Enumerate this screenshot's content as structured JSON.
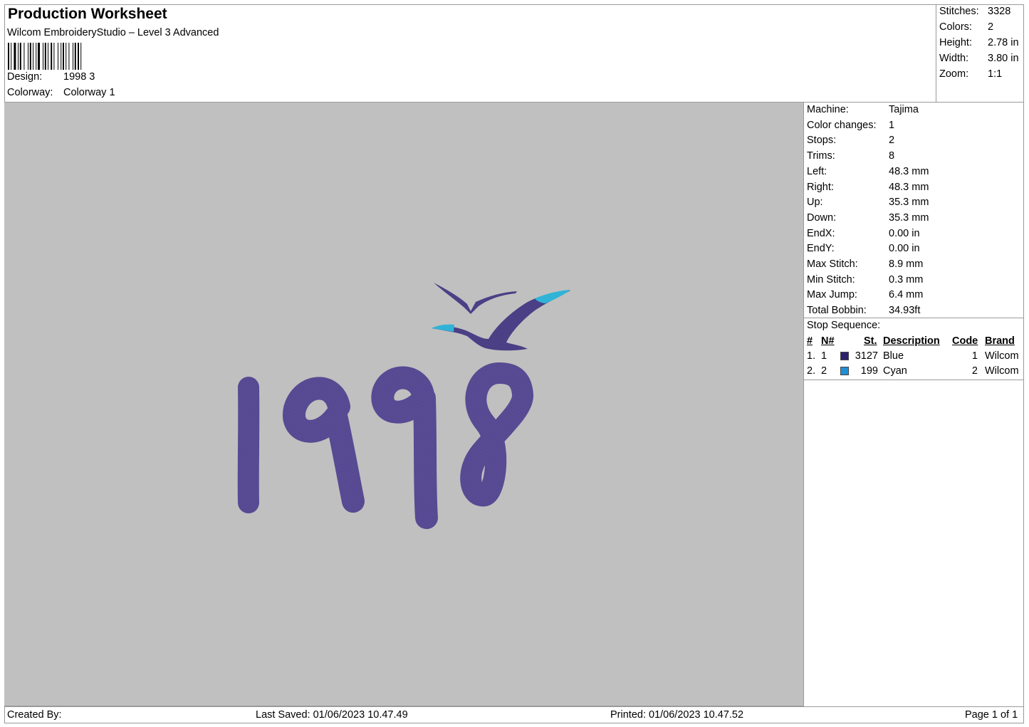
{
  "header": {
    "title": "Production Worksheet",
    "subtitle": "Wilcom EmbroideryStudio – Level 3 Advanced",
    "design_label": "Design:",
    "design_value": "1998 3",
    "colorway_label": "Colorway:",
    "colorway_value": "Colorway 1"
  },
  "stats": {
    "stitches_label": "Stitches:",
    "stitches_value": "3328",
    "colors_label": "Colors:",
    "colors_value": "2",
    "height_label": "Height:",
    "height_value": "2.78 in",
    "width_label": "Width:",
    "width_value": "3.80 in",
    "zoom_label": "Zoom:",
    "zoom_value": "1:1"
  },
  "machine_info": [
    {
      "label": "Machine:",
      "value": "Tajima"
    },
    {
      "label": "Color changes:",
      "value": "1"
    },
    {
      "label": "Stops:",
      "value": "2"
    },
    {
      "label": "Trims:",
      "value": "8"
    },
    {
      "label": "Left:",
      "value": "48.3 mm"
    },
    {
      "label": "Right:",
      "value": "48.3 mm"
    },
    {
      "label": "Up:",
      "value": "35.3 mm"
    },
    {
      "label": "Down:",
      "value": "35.3 mm"
    },
    {
      "label": "EndX:",
      "value": "0.00 in"
    },
    {
      "label": "EndY:",
      "value": "0.00 in"
    },
    {
      "label": "Max Stitch:",
      "value": "8.9 mm"
    },
    {
      "label": "Min Stitch:",
      "value": "0.3 mm"
    },
    {
      "label": "Max Jump:",
      "value": "6.4 mm"
    },
    {
      "label": "Total Bobbin:",
      "value": "34.93ft"
    }
  ],
  "stop_sequence": {
    "title": "Stop Sequence:",
    "columns": {
      "index": "#",
      "n": "N#",
      "st": "St.",
      "description": "Description",
      "code": "Code",
      "brand": "Brand"
    },
    "rows": [
      {
        "index": "1.",
        "n": "1",
        "color": "#2a1f6e",
        "st": "3127",
        "description": "Blue",
        "code": "1",
        "brand": "Wilcom"
      },
      {
        "index": "2.",
        "n": "2",
        "color": "#1e90d8",
        "st": "199",
        "description": "Cyan",
        "code": "2",
        "brand": "Wilcom"
      }
    ]
  },
  "design_colors": {
    "thread_main": "#5a4d96",
    "thread_accent": "#2fb4d8",
    "canvas": "#c0c0c0"
  },
  "footer": {
    "created_by": "Created By:",
    "last_saved": "Last Saved: 01/06/2023 10.47.49",
    "printed": "Printed: 01/06/2023 10.47.52",
    "page": "Page 1 of 1"
  }
}
